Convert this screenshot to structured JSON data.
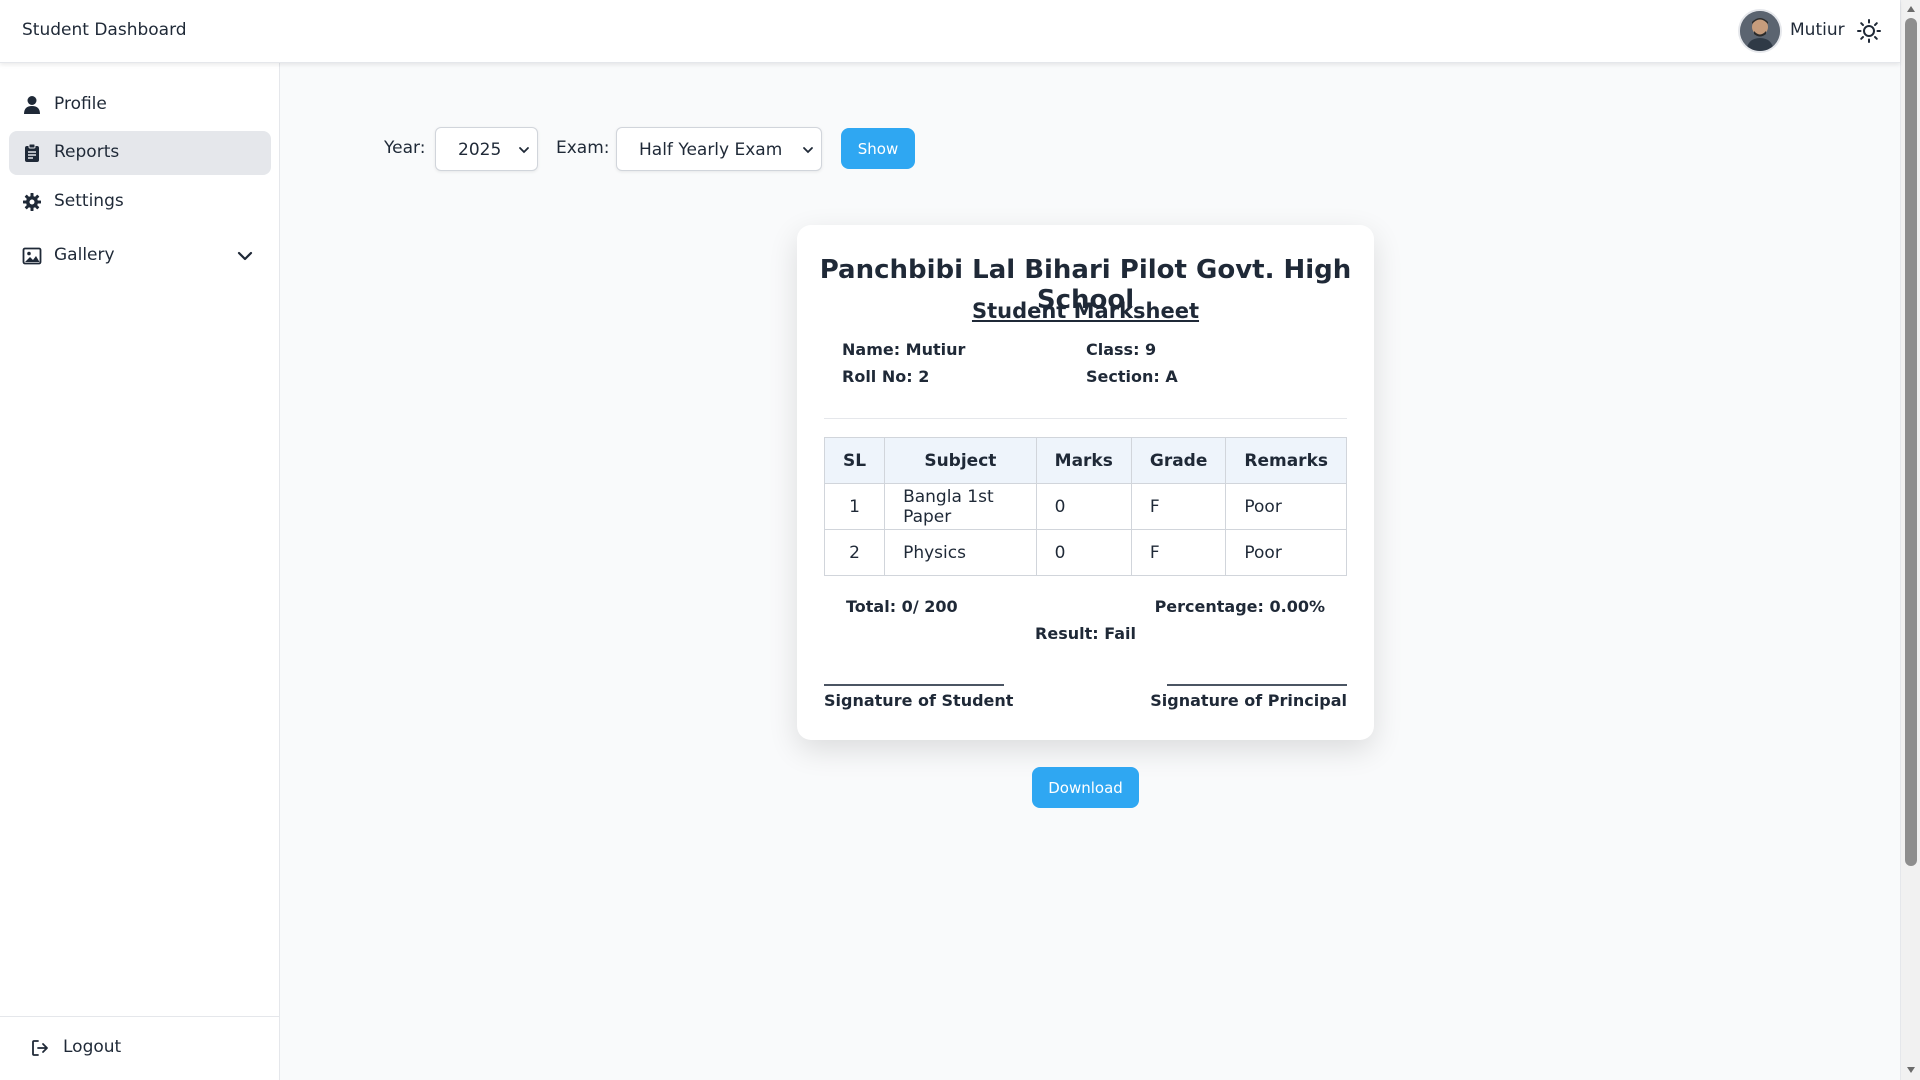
{
  "header": {
    "app_title": "Student Dashboard",
    "user_name": "Mutiur"
  },
  "sidebar": {
    "items": [
      {
        "label": "Profile",
        "icon": "user-icon"
      },
      {
        "label": "Reports",
        "icon": "clipboard-icon",
        "active": true
      },
      {
        "label": "Settings",
        "icon": "gear-icon"
      },
      {
        "label": "Gallery",
        "icon": "image-icon",
        "expandable": true
      }
    ],
    "logout_label": "Logout"
  },
  "filters": {
    "year_label": "Year:",
    "year_value": "2025",
    "exam_label": "Exam:",
    "exam_value": "Half Yearly Exam",
    "show_label": "Show"
  },
  "marksheet": {
    "school_name": "Panchbibi Lal Bihari Pilot Govt. High School",
    "title": "Student Marksheet",
    "name": "Name: Mutiur",
    "class": "Class: 9",
    "roll": "Roll No: 2",
    "section": "Section: A",
    "columns": [
      "SL",
      "Subject",
      "Marks",
      "Grade",
      "Remarks"
    ],
    "rows": [
      {
        "sl": "1",
        "subject": "Bangla 1st Paper",
        "marks": "0",
        "grade": "F",
        "remarks": "Poor"
      },
      {
        "sl": "2",
        "subject": "Physics",
        "marks": "0",
        "grade": "F",
        "remarks": "Poor"
      }
    ],
    "total": "Total: 0/ 200",
    "percentage": "Percentage: 0.00%",
    "result": "Result: Fail",
    "signature_student": "Signature of Student",
    "signature_principal": "Signature of Principal"
  },
  "download_label": "Download",
  "colors": {
    "accent": "#2fa7f2",
    "active_nav": "#e5e7eb",
    "table_header": "#eef4fb"
  }
}
